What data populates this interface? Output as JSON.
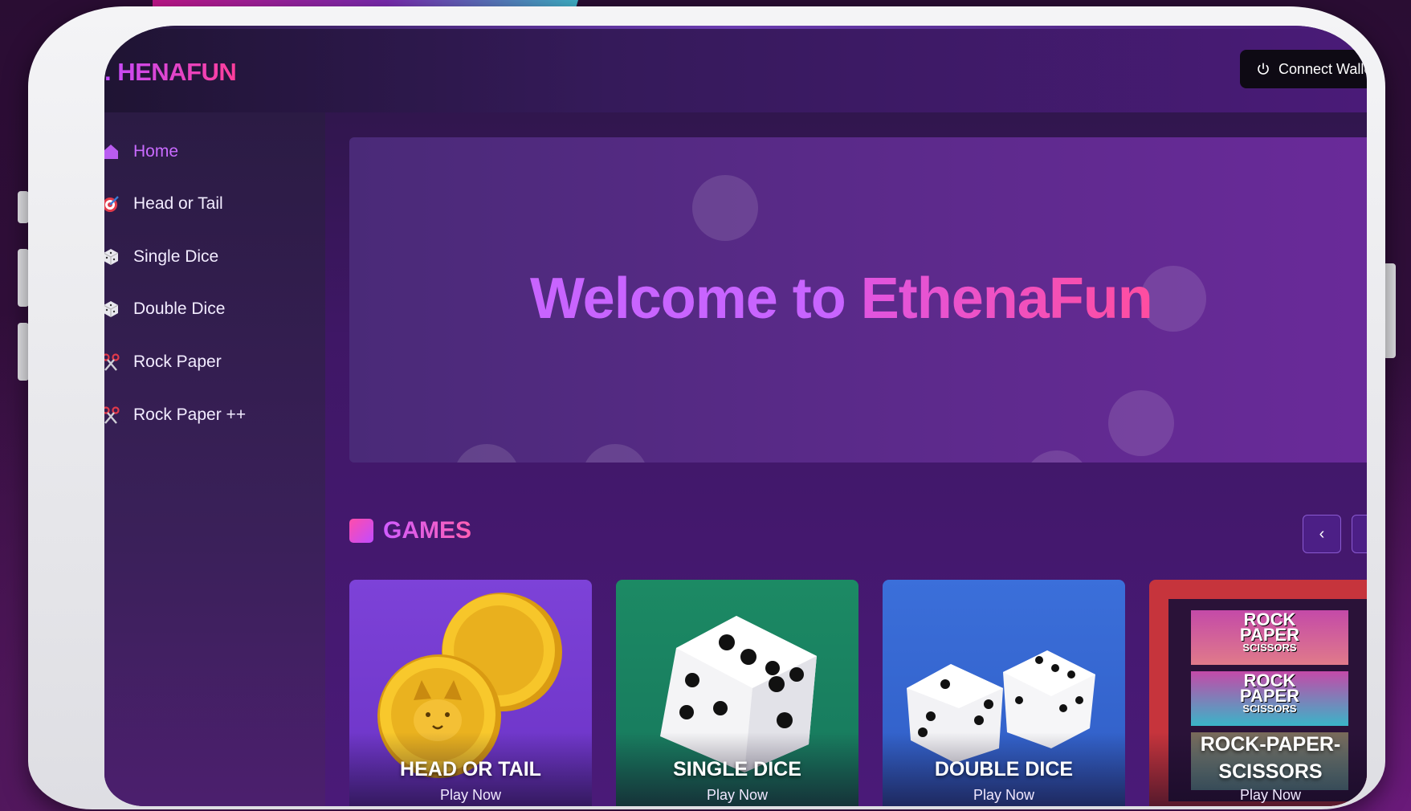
{
  "app": {
    "logo": ". HENAFUN",
    "connect_label": "Connect Walle"
  },
  "sidebar": {
    "items": [
      {
        "label": "Home",
        "icon": "home-icon",
        "active": true
      },
      {
        "label": "Head or Tail",
        "icon": "target-icon",
        "active": false
      },
      {
        "label": "Single Dice",
        "icon": "dice-icon",
        "active": false
      },
      {
        "label": "Double Dice",
        "icon": "dice-icon",
        "active": false
      },
      {
        "label": "Rock Paper",
        "icon": "scissors-icon",
        "active": false
      },
      {
        "label": "Rock Paper ++",
        "icon": "scissors-icon",
        "active": false
      }
    ]
  },
  "hero": {
    "welcome": "Welcome to",
    "brand": "EthenaFun"
  },
  "games": {
    "title": "GAMES",
    "prev_icon": "‹",
    "cards": [
      {
        "title": "HEAD OR TAIL",
        "action": "Play Now",
        "color": "#7b3fd6"
      },
      {
        "title": "SINGLE DICE",
        "action": "Play Now",
        "color": "#1a8a6a"
      },
      {
        "title": "DOUBLE DICE",
        "action": "Play Now",
        "color": "#3a6ad8"
      },
      {
        "title": "ROCK-PAPER-SCISSORS",
        "title_line1": "ROCK-PAPER-",
        "title_line2": "SCISSORS",
        "action": "Play Now",
        "color": "#c0303a",
        "art_text": [
          "ROCK",
          "PAPER",
          "SCISSORS"
        ]
      }
    ]
  },
  "colors": {
    "accent_purple": "#c864ff",
    "accent_pink": "#ff4da0"
  }
}
